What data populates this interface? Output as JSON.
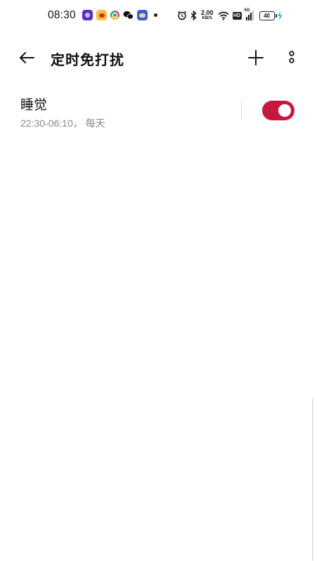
{
  "status_bar": {
    "time": "08:30",
    "net_speed_value": "2.00",
    "net_speed_unit": "KB/S",
    "hd_label": "HD",
    "network_type": "5G",
    "battery_level": "40",
    "app_icons": [
      "notes-icon",
      "weibo-icon",
      "chrome-icon",
      "wechat-icon",
      "weather-icon"
    ]
  },
  "header": {
    "title": "定时免打扰"
  },
  "rules": [
    {
      "name": "睡觉",
      "schedule": "22:30-06:10， 每天",
      "enabled": true
    }
  ],
  "colors": {
    "accent": "#c8173f",
    "secondary_text": "#8a8a8a"
  }
}
